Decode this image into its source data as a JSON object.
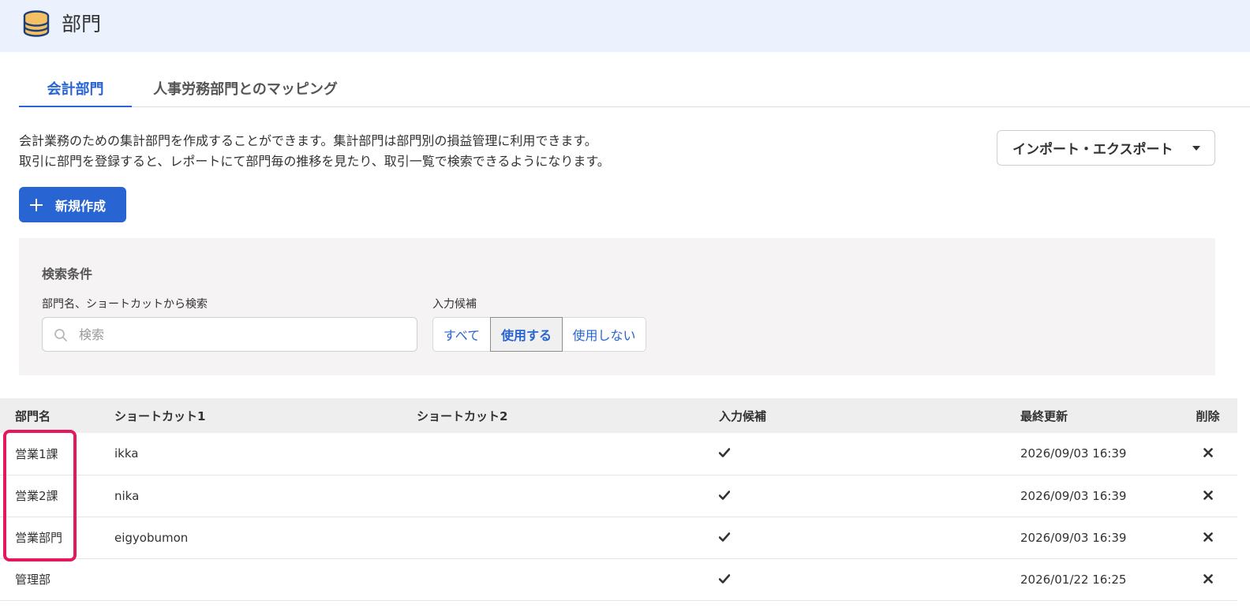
{
  "header": {
    "title": "部門",
    "icon": "database-icon"
  },
  "tabs": [
    {
      "label": "会計部門",
      "active": true
    },
    {
      "label": "人事労務部門とのマッピング",
      "active": false
    }
  ],
  "description": {
    "line1": "会計業務のための集計部門を作成することができます。集計部門は部門別の損益管理に利用できます。",
    "line2": "取引に部門を登録すると、レポートにて部門毎の推移を見たり、取引一覧で検索できるようになります。"
  },
  "toolbar": {
    "import_export_label": "インポート・エクスポート",
    "new_label": "新規作成"
  },
  "search": {
    "panel_title": "検索条件",
    "field_label": "部門名、ショートカットから検索",
    "placeholder": "検索",
    "value": "",
    "filter_label": "入力候補",
    "filter_options": [
      "すべて",
      "使用する",
      "使用しない"
    ],
    "filter_selected": "使用する"
  },
  "table": {
    "columns": [
      "部門名",
      "ショートカット1",
      "ショートカット2",
      "入力候補",
      "最終更新",
      "削除"
    ],
    "rows": [
      {
        "name": "営業1課",
        "shortcut1": "ikka",
        "shortcut2": "",
        "in_use": true,
        "updated": "2026/09/03 16:39"
      },
      {
        "name": "営業2課",
        "shortcut1": "nika",
        "shortcut2": "",
        "in_use": true,
        "updated": "2026/09/03 16:39"
      },
      {
        "name": "営業部門",
        "shortcut1": "eigyobumon",
        "shortcut2": "",
        "in_use": true,
        "updated": "2026/09/03 16:39"
      },
      {
        "name": "管理部",
        "shortcut1": "",
        "shortcut2": "",
        "in_use": true,
        "updated": "2026/01/22 16:25"
      }
    ]
  },
  "colors": {
    "accent": "#2864d2",
    "header_bg": "#ebf2fd",
    "highlight": "#e5175f"
  }
}
